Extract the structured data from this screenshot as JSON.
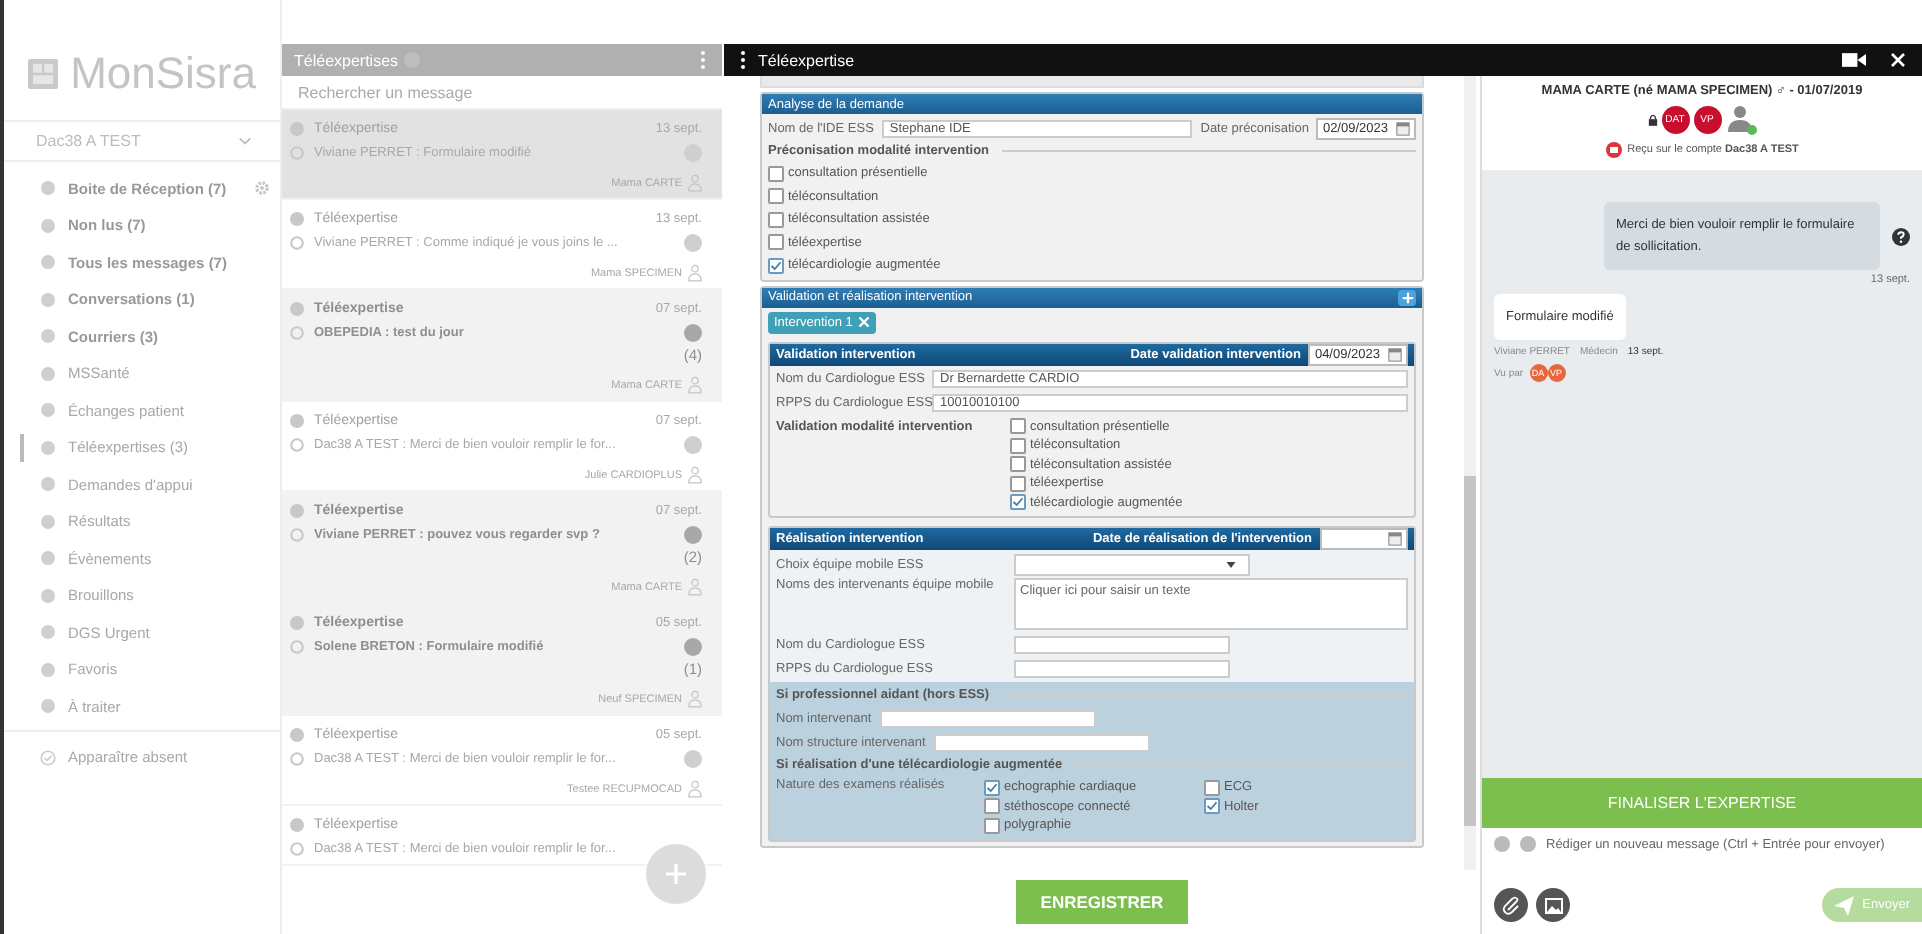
{
  "sidebar": {
    "logo": "MonSisra",
    "account": "Dac38 A TEST",
    "items": [
      {
        "label": "Boite de Réception (7)",
        "selected": false,
        "bold": true
      },
      {
        "label": "Non lus (7)",
        "selected": false,
        "bold": true
      },
      {
        "label": "Tous les messages (7)",
        "selected": false,
        "bold": true
      },
      {
        "label": "Conversations (1)",
        "selected": false,
        "bold": true
      },
      {
        "label": "Courriers (3)",
        "selected": false,
        "bold": true
      },
      {
        "label": "MSSanté",
        "selected": false,
        "bold": false
      },
      {
        "label": "Échanges patient",
        "selected": false,
        "bold": false
      },
      {
        "label": "Téléexpertises (3)",
        "selected": true,
        "bold": false
      },
      {
        "label": "Demandes d'appui",
        "selected": false,
        "bold": false
      },
      {
        "label": "Résultats",
        "selected": false,
        "bold": false
      },
      {
        "label": "Évènements",
        "selected": false,
        "bold": false
      },
      {
        "label": "Brouillons",
        "selected": false,
        "bold": false
      },
      {
        "label": "DGS Urgent",
        "selected": false,
        "bold": false
      },
      {
        "label": "Favoris",
        "selected": false,
        "bold": false
      },
      {
        "label": "À traiter",
        "selected": false,
        "bold": false
      }
    ],
    "absent": "Apparaître absent"
  },
  "message_list": {
    "title": "Téléexpertises",
    "search_placeholder": "Rechercher un message",
    "messages": [
      {
        "title": "Téléexpertise",
        "preview": "Viviane PERRET : Formulaire modifié",
        "date": "13 sept.",
        "author": "Mama CARTE",
        "selected": true,
        "unread": false
      },
      {
        "title": "Téléexpertise",
        "preview": "Viviane PERRET : Comme indiqué je vous joins le ...",
        "date": "13 sept.",
        "author": "Mama SPECIMEN",
        "selected": false,
        "unread": false
      },
      {
        "title": "Téléexpertise",
        "preview": "OBEPEDIA : test du jour",
        "date": "07 sept.",
        "count": "(4)",
        "author": "Mama CARTE",
        "selected": false,
        "unread": true
      },
      {
        "title": "Téléexpertise",
        "preview": "Dac38 A TEST : Merci de bien vouloir remplir le for...",
        "date": "07 sept.",
        "author": "Julie CARDIOPLUS",
        "selected": false,
        "unread": false
      },
      {
        "title": "Téléexpertise",
        "preview": "Viviane PERRET : pouvez vous regarder svp ?",
        "date": "07 sept.",
        "count": "(2)",
        "author": "Mama CARTE",
        "selected": false,
        "unread": true
      },
      {
        "title": "Téléexpertise",
        "preview": "Solene BRETON : Formulaire modifié",
        "date": "05 sept.",
        "count": "(1)",
        "author": "Neuf SPECIMEN",
        "selected": false,
        "unread": true
      },
      {
        "title": "Téléexpertise",
        "preview": "Dac38 A TEST : Merci de bien vouloir remplir le for...",
        "date": "05 sept.",
        "author": "Testee RECUPMOCAD",
        "selected": false,
        "unread": false
      },
      {
        "title": "Téléexpertise",
        "preview": "Dac38 A TEST : Merci de bien vouloir remplir le for...",
        "selected": false,
        "unread": false
      }
    ]
  },
  "modal": {
    "title": "Téléexpertise",
    "form": {
      "analyse": {
        "title": "Analyse de la demande",
        "ide_label": "Nom de l'IDE ESS",
        "ide_value": "Stephane IDE",
        "date_label": "Date préconisation",
        "date_value": "02/09/2023",
        "group_label": "Préconisation modalité intervention",
        "options": [
          {
            "label": "consultation présentielle",
            "checked": false
          },
          {
            "label": "téléconsultation",
            "checked": false
          },
          {
            "label": "téléconsultation assistée",
            "checked": false
          },
          {
            "label": "téléexpertise",
            "checked": false
          },
          {
            "label": "télécardiologie augmentée",
            "checked": true
          }
        ]
      },
      "section_title": "Validation et réalisation intervention",
      "tab": "Intervention 1",
      "validation": {
        "title": "Validation intervention",
        "date_label": "Date validation intervention",
        "date_value": "04/09/2023",
        "fields": [
          {
            "label": "Nom du Cardiologue ESS",
            "value": "Dr Bernardette CARDIO"
          },
          {
            "label": "RPPS du Cardiologue ESS",
            "value": "10010010100"
          }
        ],
        "group_label": "Validation modalité intervention",
        "options": [
          {
            "label": "consultation présentielle",
            "checked": false
          },
          {
            "label": "téléconsultation",
            "checked": false
          },
          {
            "label": "téléconsultation assistée",
            "checked": false
          },
          {
            "label": "téléexpertise",
            "checked": false
          },
          {
            "label": "télécardiologie augmentée",
            "checked": true
          }
        ]
      },
      "realisation": {
        "title": "Réalisation intervention",
        "date_label": "Date de réalisation de l'intervention",
        "select_label": "Choix équipe mobile ESS",
        "textarea_label": "Noms des intervenants équipe mobile",
        "textarea_placeholder": "Cliquer ici pour saisir un texte",
        "fields": [
          {
            "label": "Nom du Cardiologue ESS"
          },
          {
            "label": "RPPS du Cardiologue ESS"
          }
        ],
        "aidant_title": "Si professionnel aidant (hors ESS)",
        "aidant_fields": [
          {
            "label": "Nom intervenant"
          },
          {
            "label": "Nom structure intervenant"
          }
        ],
        "telecardio_title": "Si réalisation d'une télécardiologie augmentée",
        "exams_label": "Nature des examens réalisés",
        "exams": [
          {
            "label": "echographie cardiaque",
            "checked": true
          },
          {
            "label": "ECG",
            "checked": false
          },
          {
            "label": "stéthoscope connecté",
            "checked": false
          },
          {
            "label": "Holter",
            "checked": true
          },
          {
            "label": "polygraphie",
            "checked": false
          }
        ]
      },
      "save_button": "ENREGISTRER"
    },
    "chat": {
      "patient": "MAMA CARTE (né MAMA SPECIMEN) ♂ - 01/07/2019",
      "participants": [
        "DAT",
        "VP"
      ],
      "received": "Reçu sur le compte **Dac38 A TEST**",
      "messages": [
        {
          "kind": "outgoing",
          "text": "Merci de bien vouloir remplir le formulaire de sollicitation.",
          "date": "13 sept."
        },
        {
          "kind": "incoming",
          "text": "Formulaire modifié",
          "author": "Viviane PERRET",
          "role": "Médecin",
          "date": "13 sept.",
          "seen_label": "Vu par",
          "seen_by": [
            "DA",
            "VP"
          ]
        }
      ],
      "finalize_button": "FINALISER L'EXPERTISE",
      "compose_placeholder": "Rédiger un nouveau message (Ctrl + Entrée pour envoyer)",
      "send_button": {
        "label": "Envoyer",
        "disabled": true
      }
    }
  }
}
